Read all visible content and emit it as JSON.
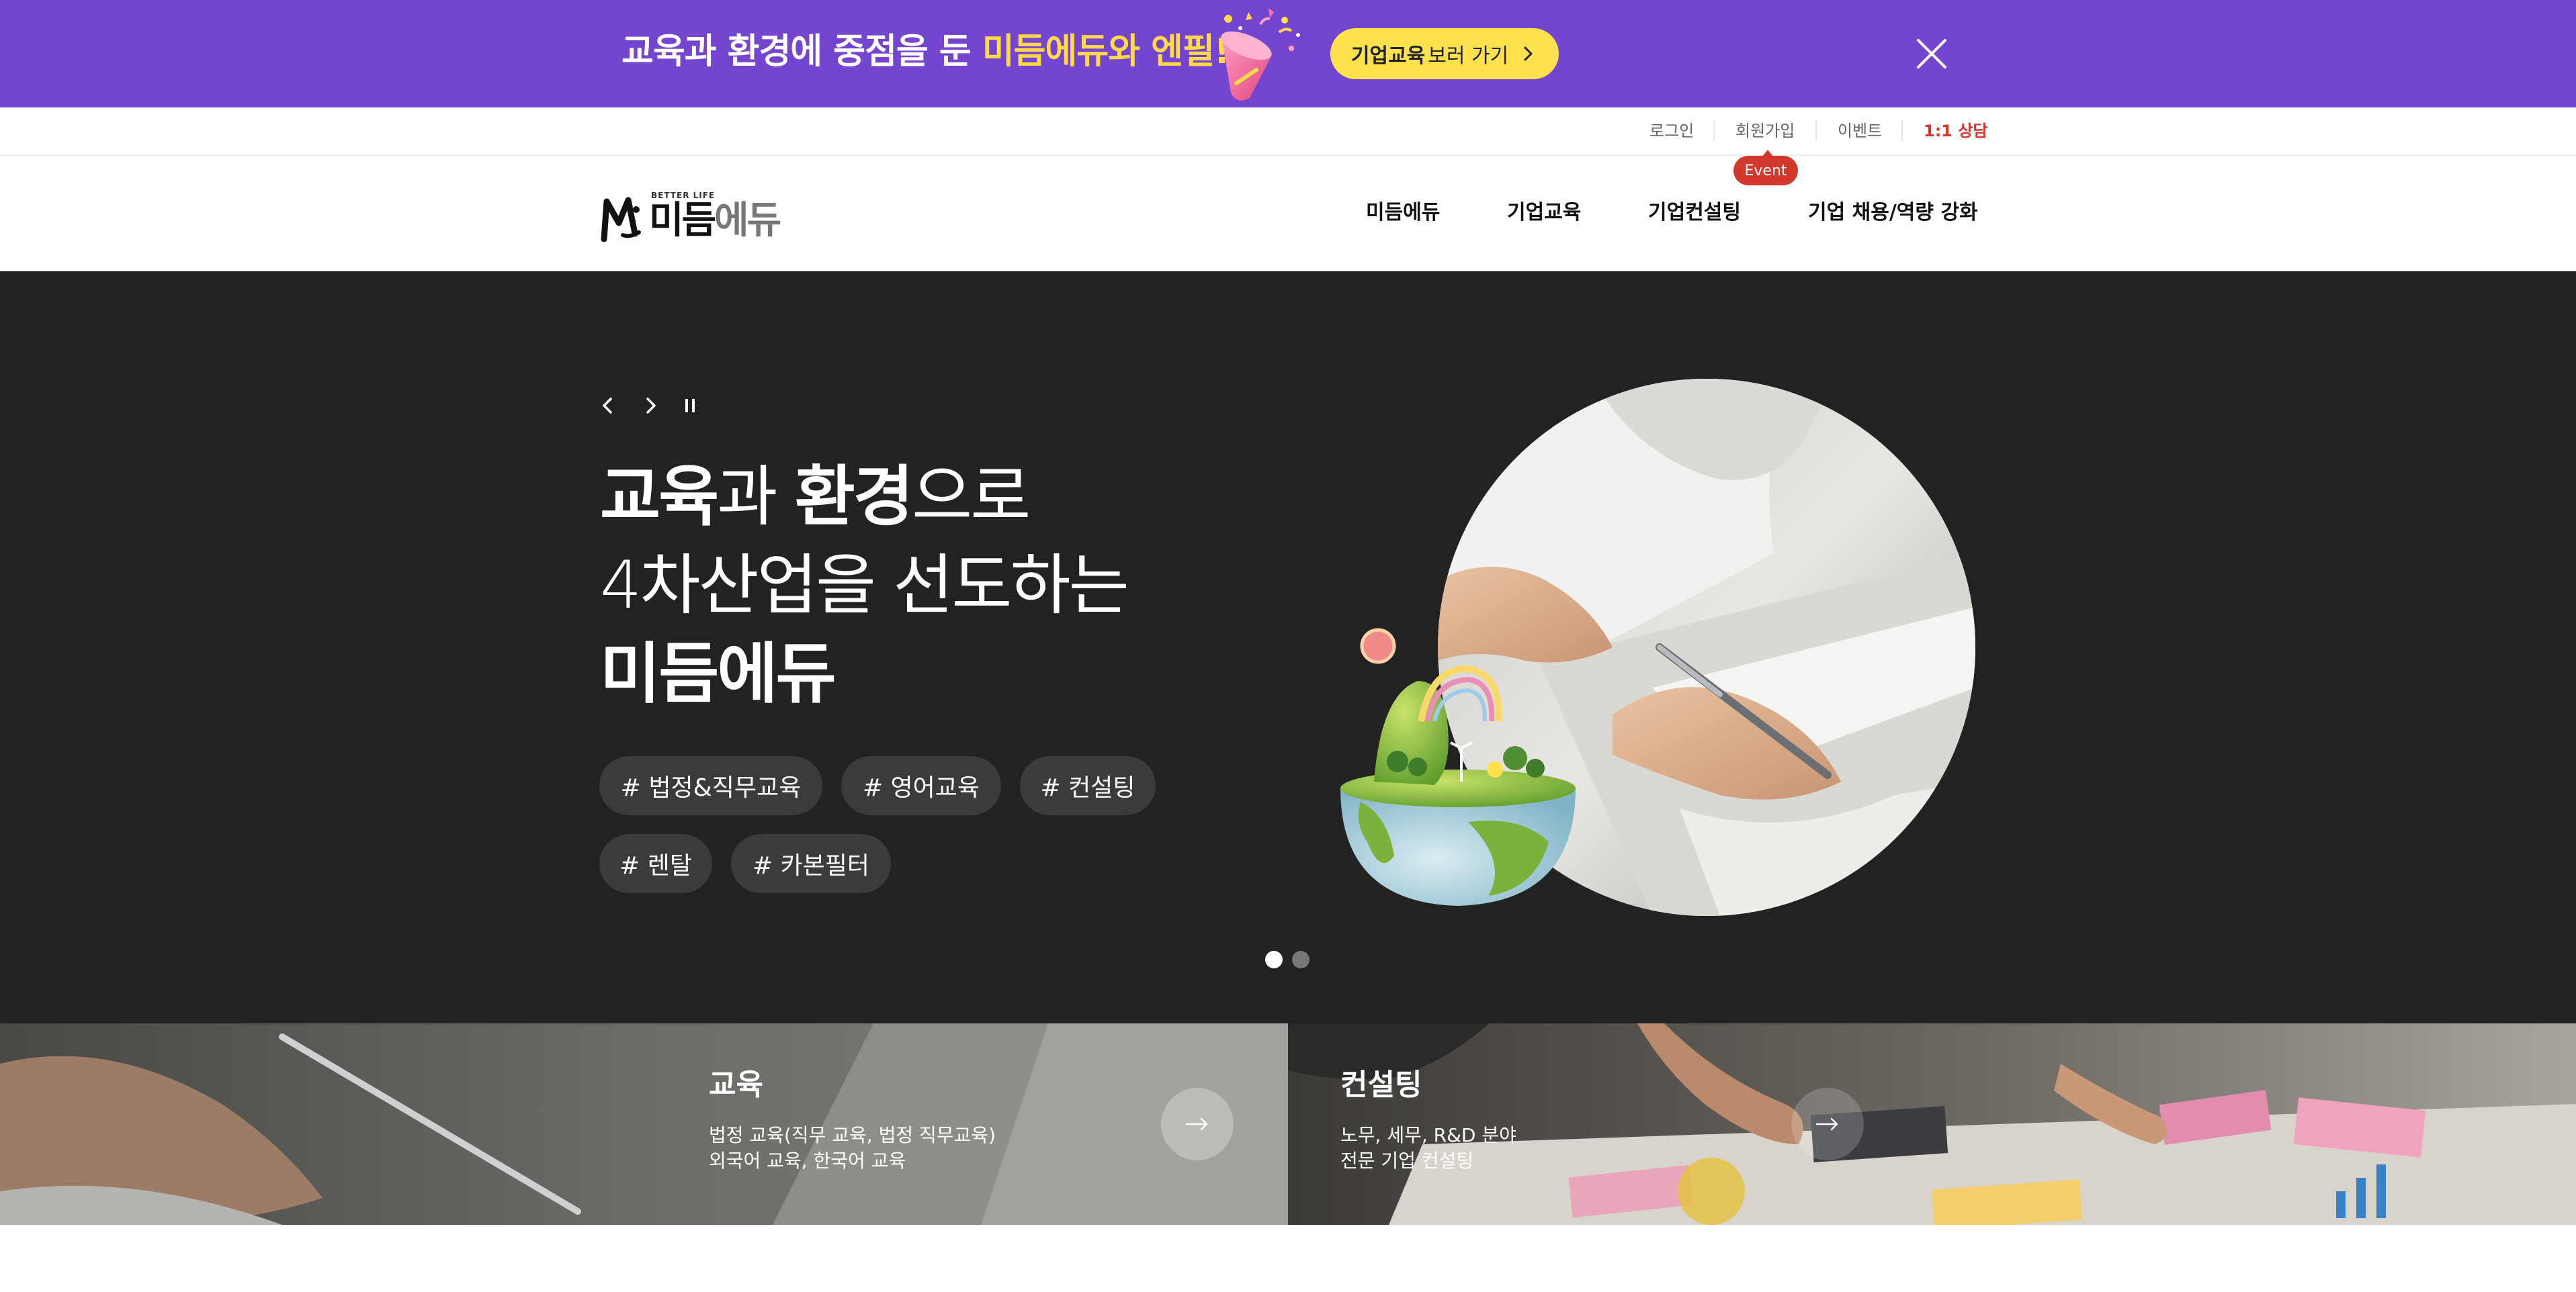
{
  "promo": {
    "text_main": "교육과 환경에 중점을 둔 ",
    "text_highlight": "미듬에듀와 엔필!",
    "button_bold": "기업교육",
    "button_rest": " 보러 가기",
    "icon_art": "party-popper-icon",
    "icon_close": "close-icon",
    "colors": {
      "background": "#7445cf",
      "highlight": "#ffd94a",
      "button": "#ffe14d"
    }
  },
  "util_nav": {
    "login": "로그인",
    "signup": "회원가입",
    "event": "이벤트",
    "consult": "1:1 상담",
    "badge": "Event",
    "colors": {
      "accent": "#d3382c"
    }
  },
  "header": {
    "logo_small": "BETTER LIFE",
    "logo_dark": "미듬",
    "logo_gray": "에듀",
    "nav": [
      "미듬에듀",
      "기업교육",
      "기업컨설팅",
      "기업 채용/역량 강화"
    ]
  },
  "hero": {
    "line1_bold1": "교육",
    "line1_light1": "과 ",
    "line1_bold2": "환경",
    "line1_light2": "으로",
    "line2": "4차산업을 선도하는",
    "line3": "미듬에듀",
    "tags": [
      "# 법정&직무교육",
      "# 영어교육",
      "# 컨설팅",
      "# 렌탈",
      "# 카본필터"
    ],
    "controls": [
      "chevron-left-icon",
      "chevron-right-icon",
      "pause-icon"
    ],
    "slide_index": 1,
    "slide_count": 2,
    "colors": {
      "background": "#222222",
      "tag": "#3b3b3b"
    }
  },
  "cards": [
    {
      "title": "교육",
      "desc": [
        "법정 교육(직무 교육, 법정 직무교육)",
        "외국어 교육, 한국어 교육"
      ],
      "icon": "arrow-right-icon"
    },
    {
      "title": "컨설팅",
      "desc": [
        "노무, 세무, R&D 분야",
        "전문 기업 컨설팅"
      ],
      "icon": "arrow-right-icon"
    }
  ]
}
